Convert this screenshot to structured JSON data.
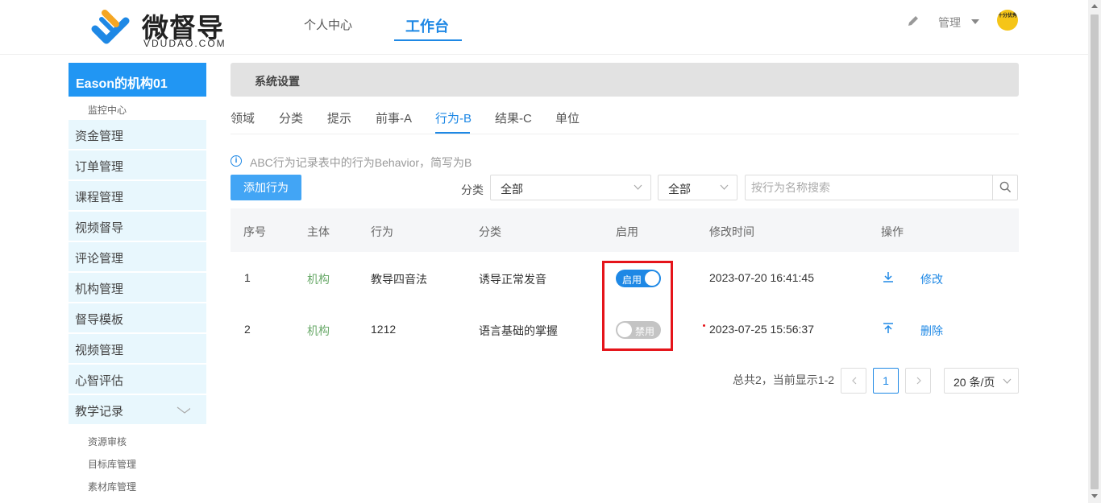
{
  "header": {
    "logo_name": "微督导",
    "logo_domain": "VDUDAO.COM",
    "nav": [
      "个人中心",
      "工作台"
    ],
    "active_nav": "工作台",
    "manage_label": "管理",
    "avatar_text": "十分优秀"
  },
  "sidebar": {
    "org_name": "Eason的机构01",
    "monitor_label": "监控中心",
    "items": [
      "资金管理",
      "订单管理",
      "课程管理",
      "视频督导",
      "评论管理",
      "机构管理",
      "督导模板",
      "视频管理",
      "心智评估",
      "教学记录"
    ],
    "sub_items": [
      "资源审核",
      "目标库管理",
      "素材库管理"
    ]
  },
  "main": {
    "section_title": "系统设置",
    "tabs": [
      "领域",
      "分类",
      "提示",
      "前事-A",
      "行为-B",
      "结果-C",
      "单位"
    ],
    "active_tab": "行为-B",
    "info_text": "ABC行为记录表中的行为Behavior，简写为B",
    "add_button": "添加行为",
    "filter_label": "分类",
    "filter_category": "全部",
    "filter_status": "全部",
    "search_placeholder": "按行为名称搜索",
    "columns": [
      "序号",
      "主体",
      "行为",
      "分类",
      "启用",
      "修改时间",
      "操作"
    ],
    "rows": [
      {
        "index": "1",
        "subject": "机构",
        "behavior": "教导四音法",
        "category": "诱导正常发音",
        "enabled": true,
        "toggle_label": "启用",
        "modified": "2023-07-20 16:41:45",
        "icon": "download-icon",
        "action": "修改"
      },
      {
        "index": "2",
        "subject": "机构",
        "behavior": "1212",
        "category": "语言基础的掌握",
        "enabled": false,
        "toggle_label": "禁用",
        "modified": "2023-07-25 15:56:37",
        "icon": "upload-icon",
        "action": "删除"
      }
    ],
    "pagination": {
      "summary": "总共2，当前显示1-2",
      "current_page": "1",
      "page_size": "20 条/页"
    }
  },
  "colors": {
    "primary": "#1e88e5",
    "sidebar_bg": "#e8f7fd",
    "highlight": "#e5141a",
    "subject_green": "#6aaa6a"
  }
}
